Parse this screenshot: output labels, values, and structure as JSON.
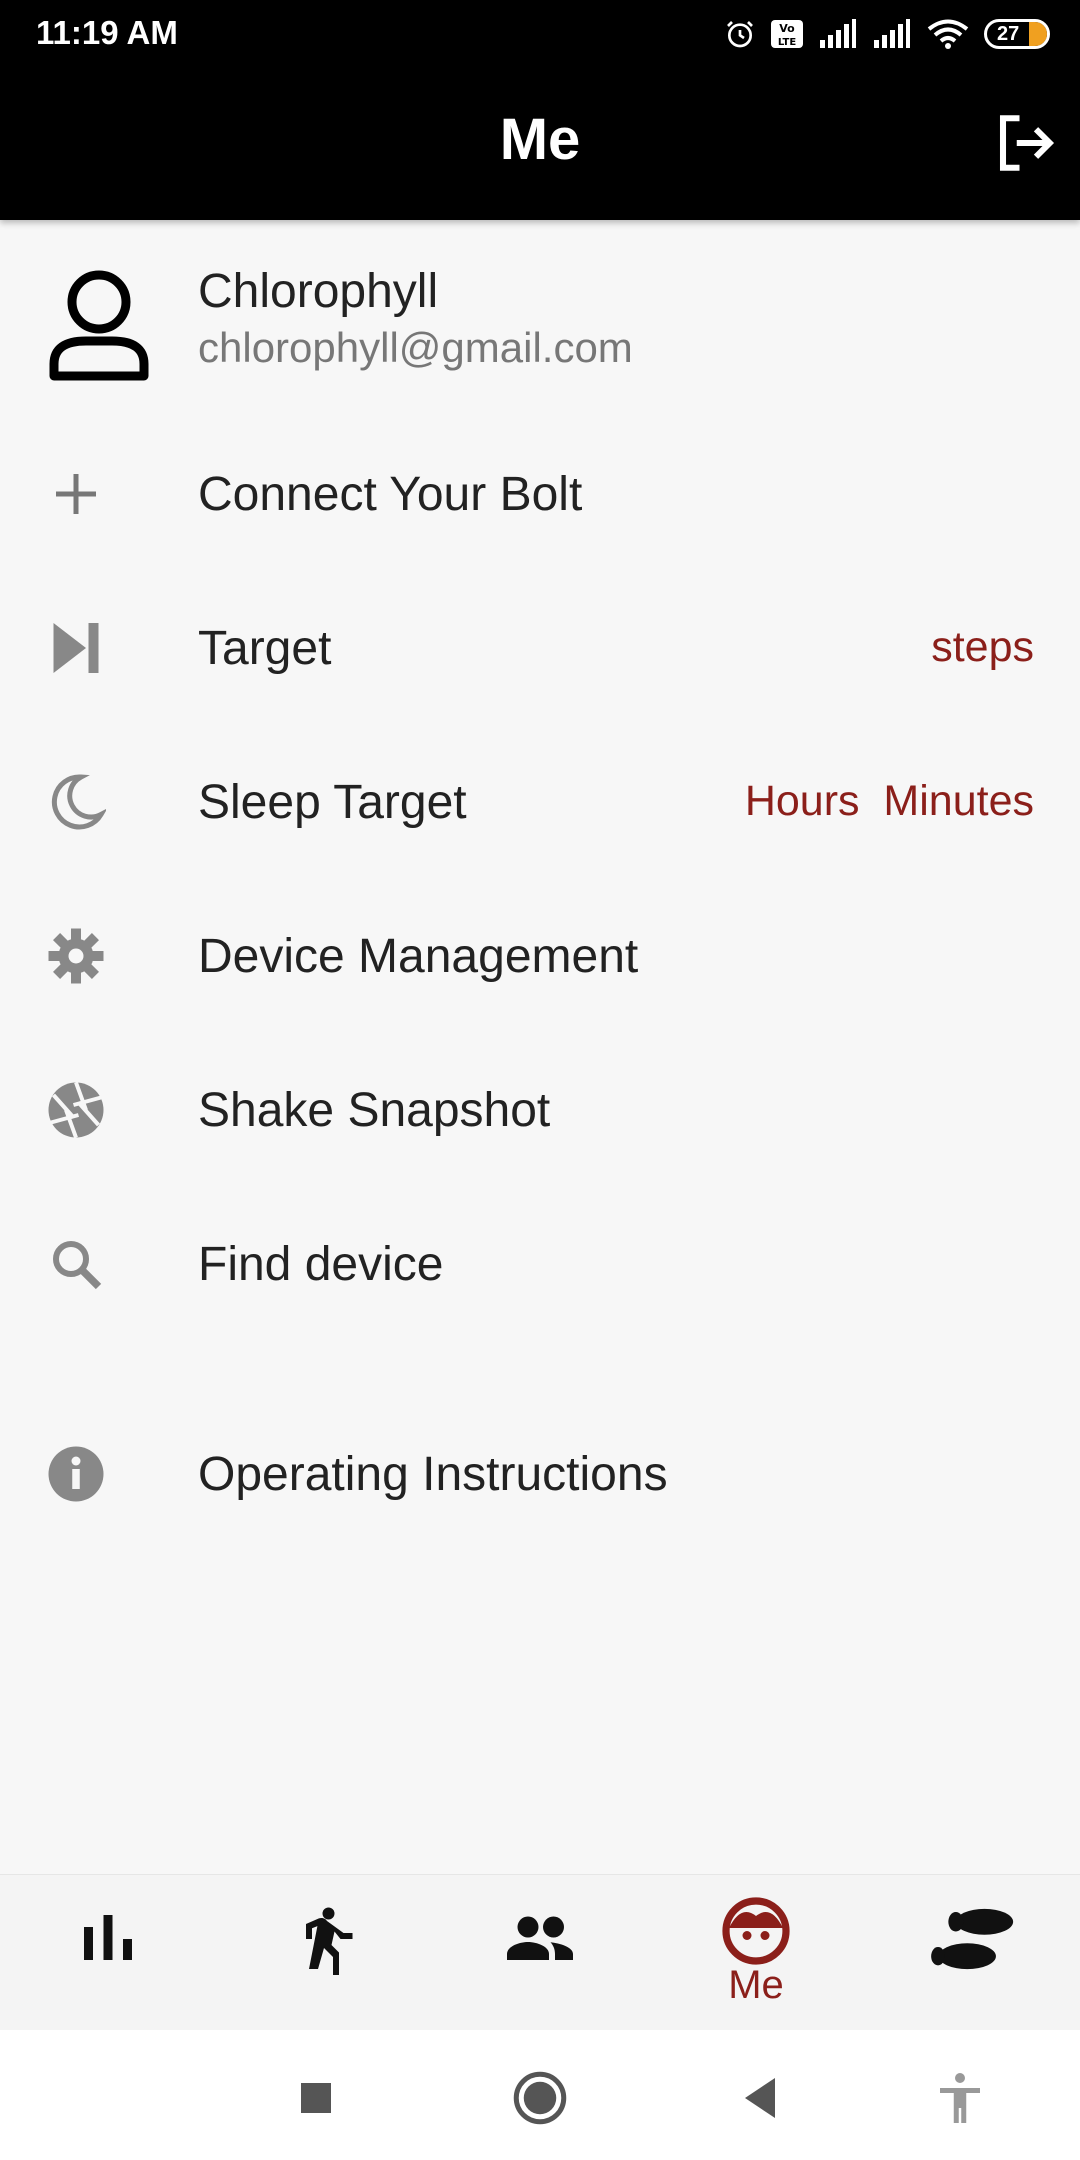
{
  "status_bar": {
    "time": "11:19 AM",
    "battery": "27",
    "icons": [
      "alarm-icon",
      "volte-icon",
      "signal-icon",
      "signal-icon",
      "wifi-icon",
      "battery-icon"
    ]
  },
  "header": {
    "title": "Me",
    "logout_icon": "logout-icon"
  },
  "profile": {
    "name": "Chlorophyll",
    "email": "chlorophyll@gmail.com",
    "avatar_icon": "person-icon"
  },
  "menu": {
    "items": [
      {
        "label": "Connect Your Bolt",
        "value": "",
        "icon": "plus-icon"
      },
      {
        "label": "Target",
        "value": "steps",
        "icon": "skip-next-icon"
      },
      {
        "label": "Sleep Target",
        "value": "Hours  Minutes",
        "icon": "moon-icon"
      },
      {
        "label": "Device Management",
        "value": "",
        "icon": "gear-icon"
      },
      {
        "label": "Shake Snapshot",
        "value": "",
        "icon": "camera-shutter-icon"
      },
      {
        "label": "Find device",
        "value": "",
        "icon": "search-icon"
      },
      {
        "label": "Operating Instructions",
        "value": "",
        "icon": "info-icon"
      }
    ]
  },
  "bottom_nav": {
    "items": [
      {
        "label": "",
        "icon": "bar-chart-icon"
      },
      {
        "label": "",
        "icon": "walking-icon"
      },
      {
        "label": "",
        "icon": "people-icon"
      },
      {
        "label": "Me",
        "icon": "face-icon",
        "active": true
      },
      {
        "label": "",
        "icon": "footprints-icon"
      }
    ]
  },
  "system_nav": {
    "icons": [
      "recents-icon",
      "home-icon",
      "back-icon",
      "accessibility-icon"
    ]
  },
  "colors": {
    "accent": "#8b1f1a",
    "header_bg": "#000000",
    "page_bg": "#f7f7f7"
  }
}
